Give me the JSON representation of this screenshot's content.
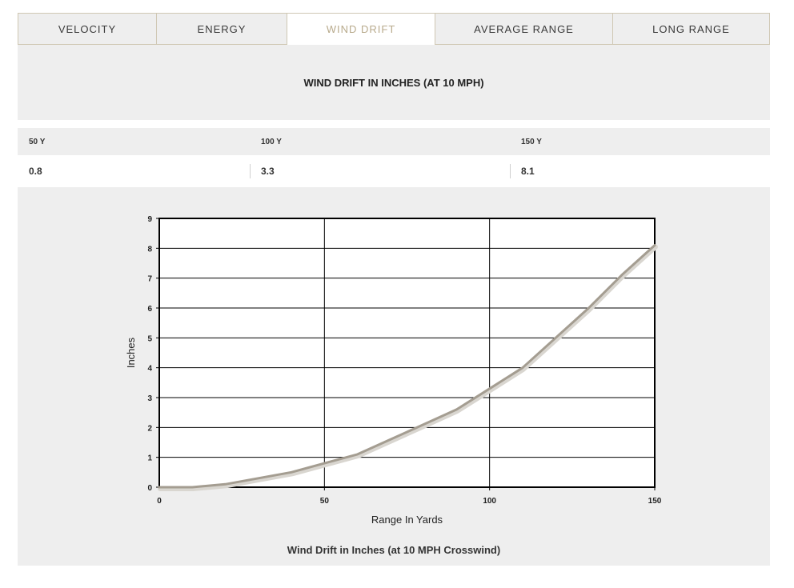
{
  "tabs": [
    {
      "label": "VELOCITY",
      "active": false
    },
    {
      "label": "ENERGY",
      "active": false
    },
    {
      "label": "WIND DRIFT",
      "active": true
    },
    {
      "label": "AVERAGE RANGE",
      "active": false
    },
    {
      "label": "LONG RANGE",
      "active": false
    }
  ],
  "header": {
    "title": "WIND DRIFT IN INCHES (AT 10 MPH)"
  },
  "stats": [
    {
      "label": "50 Y",
      "value": "0.8"
    },
    {
      "label": "100 Y",
      "value": "3.3"
    },
    {
      "label": "150 Y",
      "value": "8.1"
    }
  ],
  "colors": {
    "active_tab": "#b8aa8c",
    "line": "#a49d91",
    "panel": "#eeeeee"
  },
  "chart_data": {
    "type": "line",
    "title": "Wind Drift in Inches (at 10 MPH Crosswind)",
    "xlabel": "Range In Yards",
    "ylabel": "Inches",
    "xlim": [
      0,
      150
    ],
    "ylim": [
      0,
      9
    ],
    "x_ticks": [
      "0",
      "50",
      "100",
      "150"
    ],
    "y_ticks": [
      "0",
      "1",
      "2",
      "3",
      "4",
      "5",
      "6",
      "7",
      "8",
      "9"
    ],
    "grid": true,
    "series": [
      {
        "x": [
          0,
          10,
          20,
          30,
          40,
          50,
          60,
          70,
          80,
          90,
          100,
          110,
          120,
          130,
          140,
          150
        ],
        "values": [
          0,
          0,
          0.1,
          0.3,
          0.5,
          0.8,
          1.1,
          1.6,
          2.1,
          2.6,
          3.3,
          4.0,
          5.0,
          6.0,
          7.1,
          8.1
        ]
      }
    ]
  }
}
